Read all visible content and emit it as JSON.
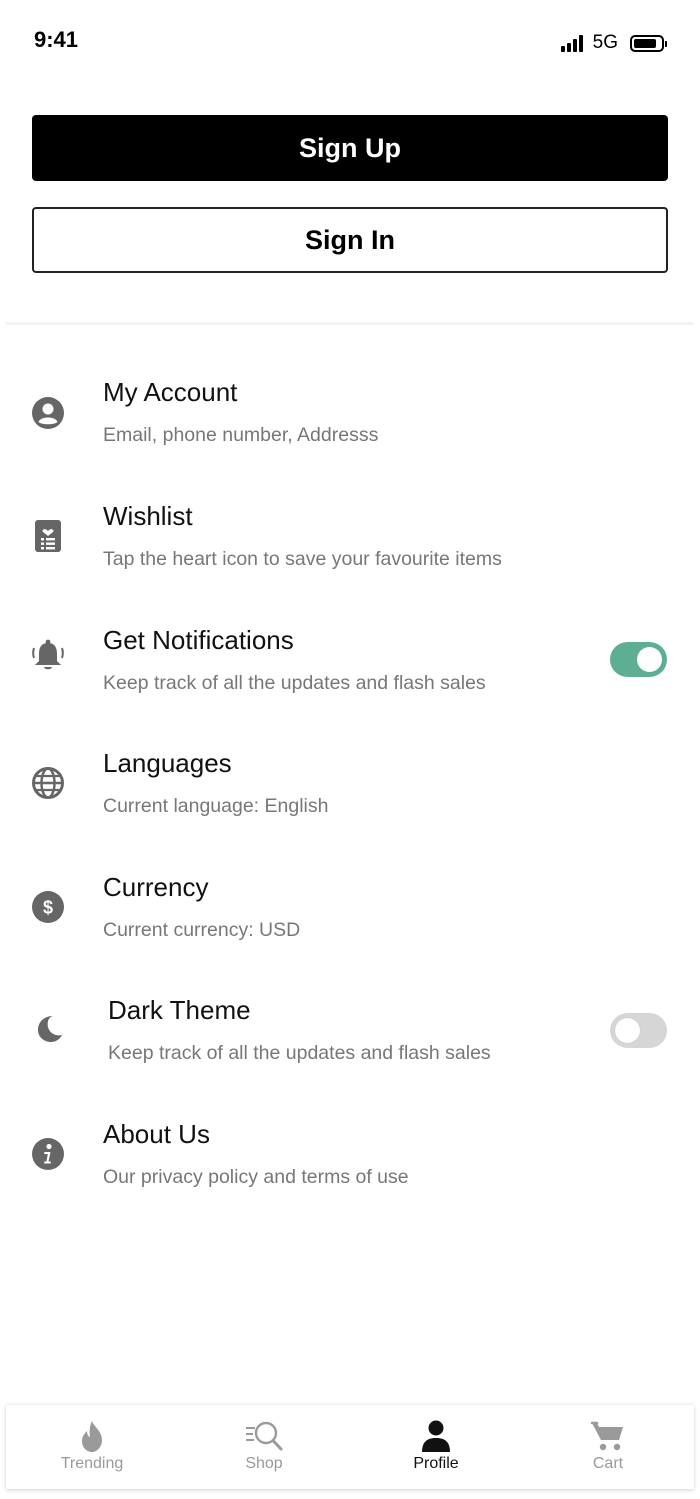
{
  "status_bar": {
    "time": "9:41",
    "network": "5G"
  },
  "auth": {
    "signup_label": "Sign Up",
    "signin_label": "Sign In"
  },
  "menu": {
    "items": [
      {
        "title": "My Account",
        "subtitle": "Email, phone number, Addresss",
        "icon": "account-circle-icon"
      },
      {
        "title": "Wishlist",
        "subtitle": "Tap the heart icon to save your favourite items",
        "icon": "wishlist-icon"
      },
      {
        "title": "Get Notifications",
        "subtitle": "Keep track of all the updates and flash sales",
        "icon": "bell-icon",
        "toggle": true
      },
      {
        "title": "Languages",
        "subtitle": "Current language: English",
        "icon": "globe-icon"
      },
      {
        "title": "Currency",
        "subtitle": "Current currency: USD",
        "icon": "dollar-icon"
      },
      {
        "title": "Dark Theme",
        "subtitle": "Keep track of all the updates and flash sales",
        "icon": "moon-icon",
        "toggle": false
      },
      {
        "title": "About Us",
        "subtitle": "Our privacy policy and terms of use",
        "icon": "info-icon"
      }
    ]
  },
  "colors": {
    "primary": "#000000",
    "toggle_on": "#5eae94",
    "toggle_off": "#d6d6d6",
    "icon_gray": "#666666",
    "subtitle_gray": "#777777"
  },
  "tab_bar": {
    "tabs": [
      {
        "label": "Trending",
        "icon": "flame-icon",
        "active": false
      },
      {
        "label": "Shop",
        "icon": "search-list-icon",
        "active": false
      },
      {
        "label": "Profile",
        "icon": "person-icon",
        "active": true
      },
      {
        "label": "Cart",
        "icon": "cart-icon",
        "active": false
      }
    ]
  }
}
